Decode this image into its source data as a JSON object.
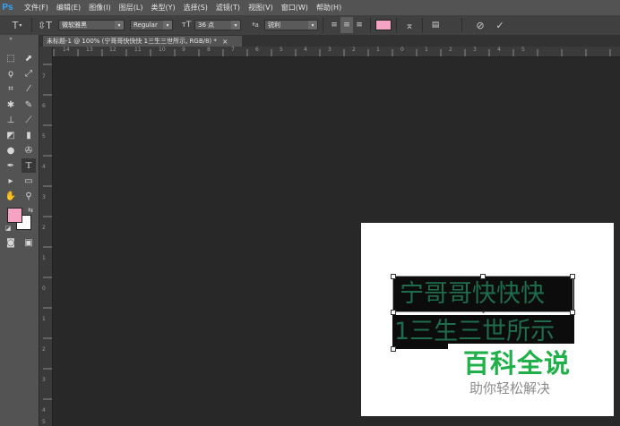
{
  "app": {
    "logo": "Ps"
  },
  "menu": [
    "文件(F)",
    "编辑(E)",
    "图像(I)",
    "图层(L)",
    "类型(Y)",
    "选择(S)",
    "滤镜(T)",
    "视图(V)",
    "窗口(W)",
    "帮助(H)"
  ],
  "options": {
    "font_family": "微软雅黑",
    "font_style": "Regular",
    "font_size": "36 点",
    "aa_icon": "ªa",
    "antialias": "锐利",
    "swatch_color": "#f4a3c3"
  },
  "document": {
    "tab_title": "未标题-1 @ 100% (宁哥哥快快快 1三生三世所示, RGB/8) *",
    "close": "×"
  },
  "text_layer": {
    "line1": "宁哥哥快快快",
    "line2": "1三生三世所示",
    "color": "#1e6c4c"
  },
  "rulers": {
    "top": [
      "14",
      "13",
      "12",
      "11",
      "10",
      "9",
      "8",
      "7",
      "6",
      "5",
      "4",
      "3",
      "2",
      "1",
      "0",
      "1",
      "2",
      "3",
      "4",
      "5"
    ],
    "left": [
      "7",
      "6",
      "5",
      "4",
      "3",
      "2",
      "1",
      "0",
      "1",
      "2",
      "3",
      "4",
      "5"
    ]
  },
  "colors": {
    "foreground": "#f4a3c3",
    "background": "#ffffff",
    "accent": "#31a8ff"
  },
  "watermark": {
    "title": "百科全说",
    "subtitle": "助你轻松解决"
  },
  "icons": [
    "type-tool-icon",
    "vertical-type-icon",
    "dropdown-arrow-icon",
    "font-size-icon",
    "align-left-icon",
    "align-center-icon",
    "align-right-icon",
    "warp-text-icon",
    "panels-icon",
    "cancel-icon",
    "commit-check-icon"
  ]
}
